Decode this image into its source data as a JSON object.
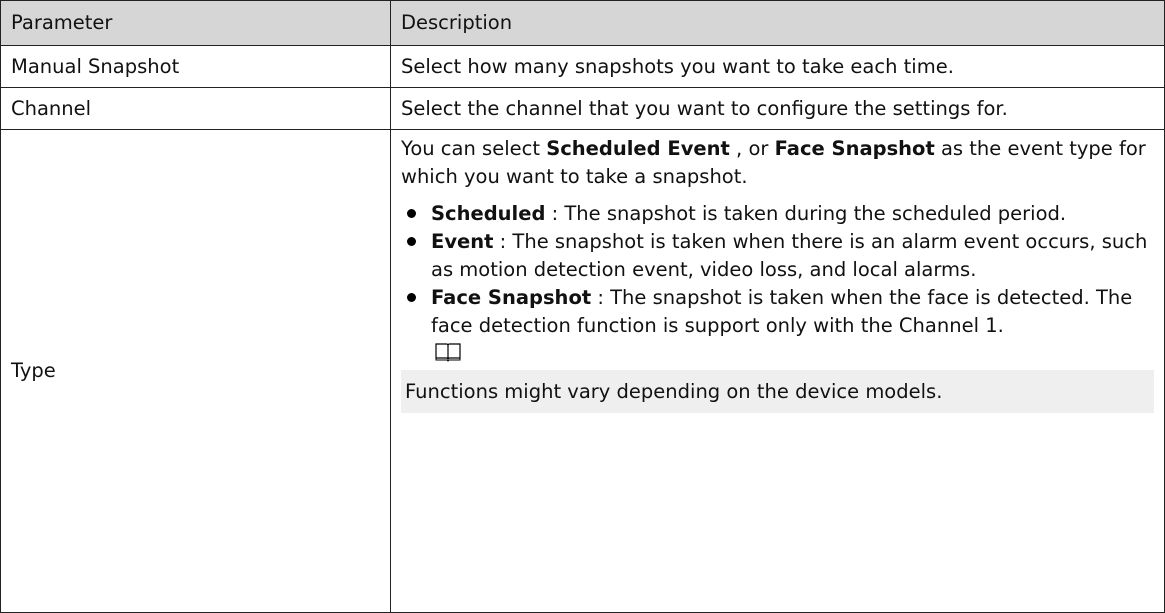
{
  "table": {
    "headers": [
      "Parameter",
      "Description"
    ],
    "rows": [
      {
        "parameter": "Manual Snapshot",
        "description": "Select how many snapshots you want to take each time."
      },
      {
        "parameter": "Channel",
        "description": "Select the channel that you want to configure the settings for."
      },
      {
        "parameter": "Type",
        "intro": {
          "t1": "You can select ",
          "b1": "Scheduled Event",
          "t2": " , or ",
          "b2": "Face Snapshot",
          "t3": " as the event type for which you want to take a snapshot."
        },
        "bullets": [
          {
            "term": "Scheduled",
            "text": " : The snapshot is taken during the scheduled period."
          },
          {
            "term": "Event",
            "text": " : The snapshot is taken when there is an alarm event occurs, such as motion detection event, video loss, and local alarms."
          },
          {
            "term": "Face Snapshot",
            "text": " : The snapshot is taken when the face is detected. The face detection function is support only with the Channel 1."
          }
        ],
        "note_icon": "book-note-icon",
        "note": "Functions might vary depending on the device models."
      }
    ]
  }
}
